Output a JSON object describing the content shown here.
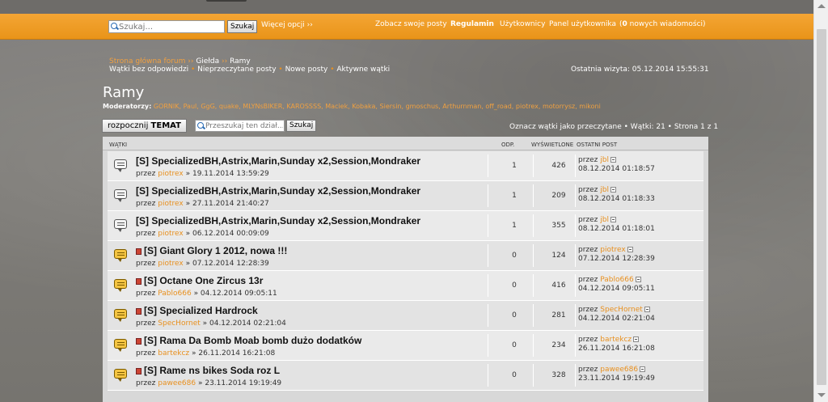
{
  "header": {
    "search_placeholder": "Szukaj...",
    "search_button": "Szukaj",
    "more_options": "Więcej opcji ››",
    "view_posts": "Zobacz swoje posty",
    "rules": "Regulamin",
    "users": "Użytkownicy",
    "user_panel": "Panel użytkownika",
    "messages_prefix": "(",
    "messages_count": "0",
    "messages_suffix": " nowych wiadomości)"
  },
  "breadcrumb": {
    "home": "Strona główna forum",
    "sep": " ›› ",
    "market": "Giełda",
    "current": "Ramy"
  },
  "quick_links": {
    "unanswered": "Wątki bez odpowiedzi",
    "unread": "Nieprzeczytane posty",
    "new_posts": "Nowe posty",
    "active": "Aktywne wątki",
    "sep": " • "
  },
  "last_visit": "Ostatnia wizyta: 05.12.2014 15:55:31",
  "forum_title": "Ramy",
  "moderators_label": "Moderatorzy:",
  "moderators": "GORNIK, Paul, GgG, quake, MLYNsBIKER, KAROSSSS, Maciek, Kobaka, Siersin, gmoschus, Arthurnman, off_road, piotrex, motorrysz, mikoni",
  "new_topic_prefix": "rozpocznij ",
  "new_topic_bold": "TEMAT",
  "forum_search_placeholder": "Przeszukaj ten dział...",
  "forum_search_button": "Szukaj",
  "pagination": "Oznacz wątki jako przeczytane • Wątki: 21 • Strona 1 z 1",
  "table_headers": {
    "topics": "Wątki",
    "replies": "Odp.",
    "views": "Wyświetlone",
    "last_post": "Ostatni post"
  },
  "topics": [
    {
      "title": "[S] SpecializedBH,Astrix,Marin,Sunday x2,Session,Mondraker",
      "author": "piotrex",
      "date": " » 19.11.2014 13:59:29",
      "replies": "1",
      "views": "426",
      "last_author": "jbl",
      "last_date": "08.12.2014 01:18:57",
      "new": false
    },
    {
      "title": "[S] SpecializedBH,Astrix,Marin,Sunday x2,Session,Mondraker",
      "author": "piotrex",
      "date": " » 27.11.2014 21:40:27",
      "replies": "1",
      "views": "209",
      "last_author": "jbl",
      "last_date": "08.12.2014 01:18:33",
      "new": false
    },
    {
      "title": "[S] SpecializedBH,Astrix,Marin,Sunday x2,Session,Mondraker",
      "author": "piotrex",
      "date": " » 06.12.2014 00:09:09",
      "replies": "1",
      "views": "355",
      "last_author": "jbl",
      "last_date": "08.12.2014 01:18:01",
      "new": false
    },
    {
      "title": "[S] Giant Glory 1 2012, nowa !!!",
      "author": "piotrex",
      "date": " » 07.12.2014 12:28:39",
      "replies": "0",
      "views": "124",
      "last_author": "piotrex",
      "last_date": "07.12.2014 12:28:39",
      "new": true
    },
    {
      "title": "[S] Octane One Zircus 13r",
      "author": "Pablo666",
      "date": " » 04.12.2014 09:05:11",
      "replies": "0",
      "views": "416",
      "last_author": "Pablo666",
      "last_date": "04.12.2014 09:05:11",
      "new": true
    },
    {
      "title": "[S] Specialized Hardrock",
      "author": "SpecHornet",
      "date": " » 04.12.2014 02:21:04",
      "replies": "0",
      "views": "281",
      "last_author": "SpecHornet",
      "last_date": "04.12.2014 02:21:04",
      "new": true
    },
    {
      "title": "[S] Rama Da Bomb Moab bomb dużo dodatków",
      "author": "bartekcz",
      "date": " » 26.11.2014 16:21:08",
      "replies": "0",
      "views": "234",
      "last_author": "bartekcz",
      "last_date": "26.11.2014 16:21:08",
      "new": true
    },
    {
      "title": "[S] Rame ns bikes Soda roz L",
      "author": "pawee686",
      "date": " » 23.11.2014 19:19:49",
      "replies": "0",
      "views": "328",
      "last_author": "pawee686",
      "last_date": "23.11.2014 19:19:49",
      "new": true
    }
  ],
  "by_label": "przez "
}
